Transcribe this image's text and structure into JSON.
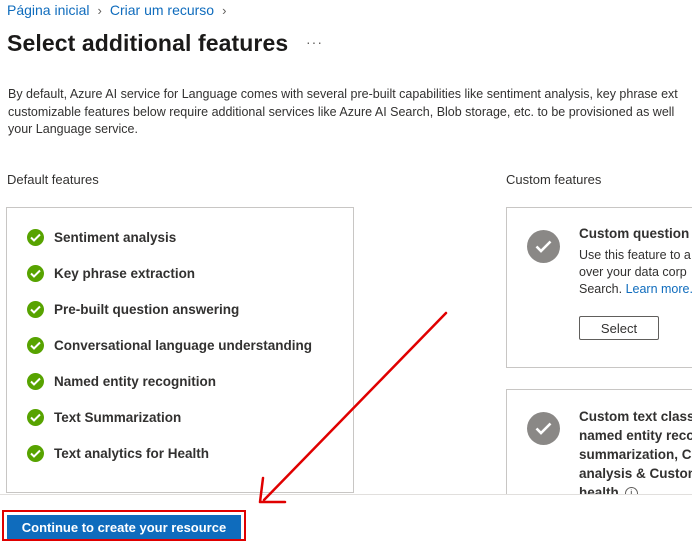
{
  "breadcrumb": {
    "home": "Página inicial",
    "current": "Criar um recurso"
  },
  "page": {
    "title": "Select additional features",
    "more": "···",
    "description": "By default, Azure AI service for Language comes with several pre-built capabilities like sentiment analysis, key phrase ext\ncustomizable features below require additional services like Azure AI Search, Blob storage, etc. to be provisioned as well\nyour Language service."
  },
  "default_features": {
    "label": "Default features",
    "items": [
      "Sentiment analysis",
      "Key phrase extraction",
      "Pre-built question answering",
      "Conversational language understanding",
      "Named entity recognition",
      "Text Summarization",
      "Text analytics for Health"
    ]
  },
  "custom_features": {
    "label": "Custom features",
    "card1": {
      "title": "Custom question a",
      "description_prefix": "Use this feature to a\nover your data corp\nSearch. ",
      "learn_more": "Learn more.",
      "select_label": "Select"
    },
    "card2": {
      "title": "Custom text classi\nnamed entity reco\nsummarization, Cu\nanalysis & Custom\nhealth"
    }
  },
  "footer": {
    "primary_label": "Continue to create your resource"
  },
  "colors": {
    "accent": "#0f6cbd",
    "check_green": "#57a300",
    "highlight_red": "#e00000"
  }
}
